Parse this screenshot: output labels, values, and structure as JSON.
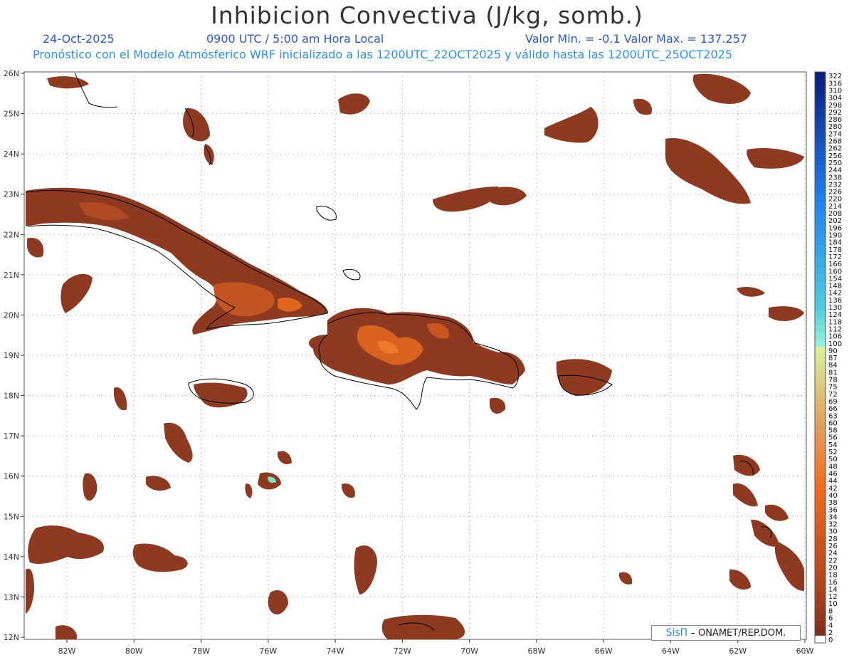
{
  "title": "Inhibicion Convectiva (J/kg, somb.)",
  "header": {
    "date": "24-Oct-2025",
    "time": "0900 UTC / 5:00 am Hora Local",
    "value_range": "Valor Min. = -0.1  Valor Max. = 137.257",
    "model_info": "Pronóstico con el Modelo Atmósferico WRF inicializado a las 1200UTC_22OCT2025 y válido hasta las  1200UTC_25OCT2025"
  },
  "map": {
    "lat_labels": [
      "26N",
      "25N",
      "24N",
      "23N",
      "22N",
      "21N",
      "20N",
      "19N",
      "18N",
      "17N",
      "16N",
      "15N",
      "14N",
      "13N",
      "12N"
    ],
    "lon_labels": [
      "82W",
      "80W",
      "78W",
      "76W",
      "74W",
      "72W",
      "70W",
      "68W",
      "66W",
      "64W",
      "62W",
      "60W"
    ],
    "colors": {
      "low": "#7a2a1e",
      "mid": "#a33f1f",
      "hot": "#e0661e",
      "peak": "#7fe0c8",
      "coast": "#000000",
      "grid": "#999999"
    }
  },
  "colorbar": {
    "labels": [
      "322",
      "316",
      "310",
      "304",
      "298",
      "292",
      "286",
      "280",
      "274",
      "268",
      "262",
      "256",
      "250",
      "244",
      "238",
      "232",
      "226",
      "220",
      "214",
      "208",
      "202",
      "196",
      "190",
      "184",
      "178",
      "172",
      "166",
      "160",
      "154",
      "148",
      "142",
      "136",
      "130",
      "124",
      "118",
      "112",
      "106",
      "100",
      "90",
      "87",
      "84",
      "81",
      "78",
      "75",
      "72",
      "69",
      "66",
      "63",
      "60",
      "58",
      "56",
      "54",
      "52",
      "50",
      "48",
      "46",
      "44",
      "42",
      "40",
      "38",
      "36",
      "34",
      "32",
      "30",
      "28",
      "26",
      "24",
      "22",
      "20",
      "18",
      "16",
      "14",
      "12",
      "10",
      "8",
      "6",
      "4",
      "2",
      "0"
    ]
  },
  "credit": {
    "logo": "SisΠ",
    "text": "– ONAMET/REP.DOM."
  }
}
